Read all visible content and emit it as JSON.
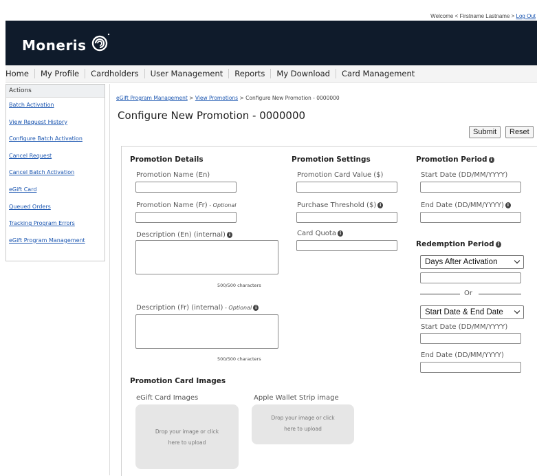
{
  "welcome": {
    "text": "Welcome < Firstname Lastname > ",
    "logout": "Log Out"
  },
  "brand": {
    "name": "Moneris"
  },
  "nav": [
    "Home",
    "My Profile",
    "Cardholders",
    "User Management",
    "Reports",
    "My Download",
    "Card Management"
  ],
  "sidebar": {
    "title": "Actions",
    "items": [
      "Batch Activation",
      "View Request History",
      "Configure Batch Activation",
      "Cancel Request",
      "Cancel Batch Activation",
      "eGift Card",
      "Queued Orders",
      "Tracking Program Errors",
      "eGift Program Management"
    ]
  },
  "breadcrumb": {
    "link1": "eGift Program Management",
    "sep1": " > ",
    "link2": "View Promotions",
    "sep2": " > ",
    "current": "Configure New Promotion - 0000000"
  },
  "page_title": "Configure New Promotion - 0000000",
  "buttons": {
    "submit": "Submit",
    "reset": "Reset"
  },
  "details": {
    "title": "Promotion Details",
    "name_en": "Promotion Name (En)",
    "name_fr": "Promotion Name (Fr)",
    "name_fr_optional": " - Optional",
    "desc_en": "Description (En) (internal)",
    "desc_en_counter": "500/500 characters",
    "desc_fr": "Description (Fr) (internal)",
    "desc_fr_optional": " - Optional",
    "desc_fr_counter": "500/500 characters"
  },
  "settings": {
    "title": "Promotion Settings",
    "card_value": "Promotion Card Value ($)",
    "purchase_threshold": "Purchase Threshold ($)",
    "card_quota": "Card Quota"
  },
  "period": {
    "title": "Promotion Period",
    "start_date": "Start Date (DD/MM/YYYY)",
    "end_date": "End Date (DD/MM/YYYY)"
  },
  "redemption": {
    "title": "Redemption Period",
    "select1": "Days After Activation",
    "or": "Or",
    "select2": "Start Date & End Date",
    "start_date": "Start Date (DD/MM/YYYY)",
    "end_date": "End Date (DD/MM/YYYY)"
  },
  "images": {
    "title": "Promotion Card Images",
    "egift_label": "eGift Card Images",
    "egift_drop_line1": "Drop your image or click",
    "egift_drop_line2": "here to upload",
    "wallet_label": "Apple Wallet Strip image",
    "wallet_drop_line1": "Drop your image or click",
    "wallet_drop_line2": "here to upload"
  },
  "info_icon_glyph": "i"
}
